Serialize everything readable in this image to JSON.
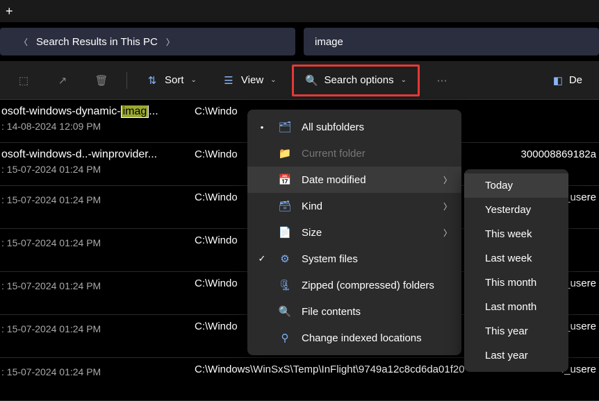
{
  "titlebar": {
    "plus": "+"
  },
  "breadcrumb": {
    "text": "Search Results in This PC"
  },
  "search": {
    "value": "image"
  },
  "toolbar": {
    "sort": "Sort",
    "view": "View",
    "search_options": "Search options",
    "details": "De"
  },
  "results": [
    {
      "name_pre": "osoft-windows-dynamic-",
      "name_hl": "imag",
      "name_post": "...",
      "date": ": 14-08-2024 12:09 PM",
      "path": "C:\\Windo",
      "right": ""
    },
    {
      "name_pre": "osoft-windows-d..-winprovider...",
      "date": ": 15-07-2024 01:24 PM",
      "path": "C:\\Windo",
      "right": "300008869182a"
    },
    {
      "name_pre": "",
      "date": ": 15-07-2024 01:24 PM",
      "path": "C:\\Windo",
      "right": "4_usere"
    },
    {
      "name_pre": "",
      "date": ": 15-07-2024 01:24 PM",
      "path": "C:\\Windo",
      "right": ""
    },
    {
      "name_pre": "",
      "date": ": 15-07-2024 01:24 PM",
      "path": "C:\\Windo",
      "right": "4_usere"
    },
    {
      "name_pre": "",
      "date": ": 15-07-2024 01:24 PM",
      "path": "C:\\Windo",
      "right": "4_usere"
    },
    {
      "name_pre": "",
      "date": ": 15-07-2024 01:24 PM",
      "path": "C:\\Windows\\WinSxS\\Temp\\InFlight\\9749a12c8cd6da01f20",
      "right": "4_usere"
    }
  ],
  "menu": {
    "all_subfolders": "All subfolders",
    "current_folder": "Current folder",
    "date_modified": "Date modified",
    "kind": "Kind",
    "size": "Size",
    "system_files": "System files",
    "zipped": "Zipped (compressed) folders",
    "file_contents": "File contents",
    "change_indexed": "Change indexed locations"
  },
  "submenu": {
    "today": "Today",
    "yesterday": "Yesterday",
    "this_week": "This week",
    "last_week": "Last week",
    "this_month": "This month",
    "last_month": "Last month",
    "this_year": "This year",
    "last_year": "Last year"
  }
}
